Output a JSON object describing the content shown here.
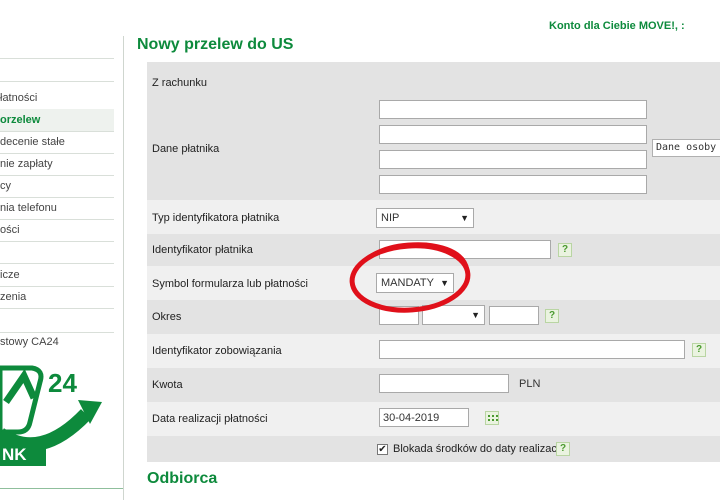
{
  "header": {
    "account_link": "Konto dla Ciebie MOVE!, :"
  },
  "sidebar": {
    "items": [
      {
        "label": ""
      },
      {
        "label": "łatności"
      },
      {
        "label": "orzelew"
      },
      {
        "label": "decenie stałe"
      },
      {
        "label": "nie zapłaty"
      },
      {
        "label": "cy"
      },
      {
        "label": "nia telefonu"
      },
      {
        "label": "ości"
      },
      {
        "label": ""
      },
      {
        "label": "icze"
      },
      {
        "label": "zenia"
      }
    ],
    "promo_text": "stowy CA24",
    "logo_number": "24",
    "logo_word": "NK"
  },
  "page": {
    "title": "Nowy przelew do US"
  },
  "form": {
    "from_account_label": "Z rachunku",
    "payer_data_label": "Dane płatnika",
    "payer_lines": [
      "",
      "",
      "",
      ""
    ],
    "payer_side_note": "Dane osoby z",
    "payer_id_type_label": "Typ identyfikatora płatnika",
    "payer_id_type_value": "NIP",
    "payer_id_label": "Identyfikator płatnika",
    "payer_id_value": "",
    "form_symbol_label": "Symbol formularza lub płatności",
    "form_symbol_value": "MANDATY",
    "period_label": "Okres",
    "period_year": "",
    "period_type": "",
    "period_number": "",
    "liability_id_label": "Identyfikator zobowiązania",
    "liability_id_value": "",
    "amount_label": "Kwota",
    "amount_value": "",
    "currency": "PLN",
    "execution_date_label": "Data realizacji płatności",
    "execution_date_value": "30-04-2019",
    "block_funds_label": "Blokada środków do daty realizacji",
    "block_funds_checked": true,
    "help_glyph": "?",
    "dropdown_glyph": "▼",
    "check_glyph": "✔"
  },
  "recipient": {
    "title": "Odbiorca"
  },
  "colors": {
    "brand_green": "#0d8a3c",
    "row_gray": "#e3e3e3",
    "annotation_red": "#e0101a"
  },
  "icons": [
    "help-icon",
    "calendar-icon",
    "dropdown-arrow-icon",
    "checkmark-icon"
  ]
}
